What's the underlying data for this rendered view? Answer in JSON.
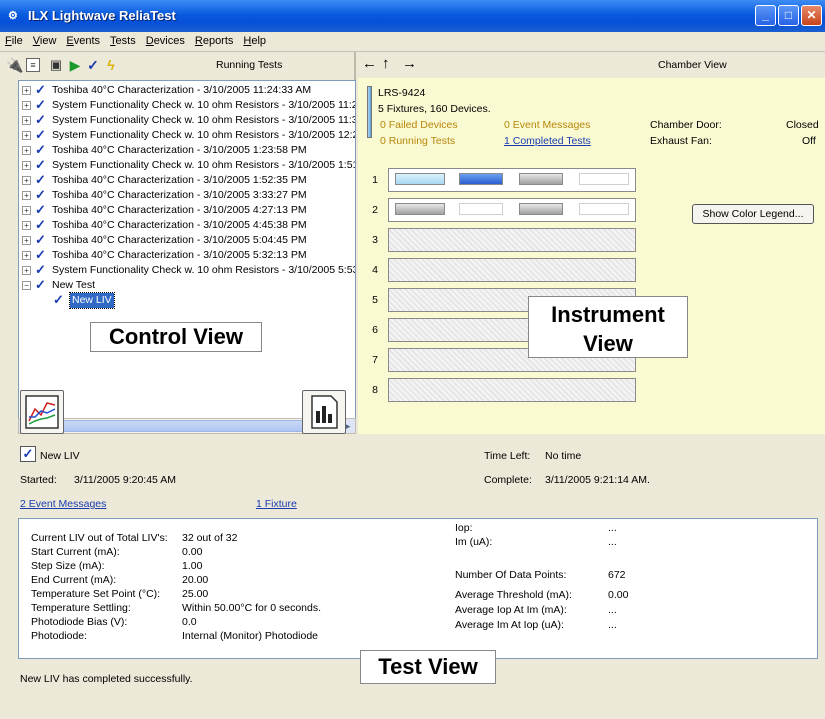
{
  "window": {
    "title": "ILX Lightwave ReliaTest",
    "min": "_",
    "max": "□",
    "close": "✕"
  },
  "menu": [
    "File",
    "View",
    "Events",
    "Tests",
    "Devices",
    "Reports",
    "Help"
  ],
  "control": {
    "header": "Running Tests",
    "tree": [
      {
        "text": "Toshiba 40°C Characterization - 3/10/2005 11:24:33 AM",
        "expander": "+"
      },
      {
        "text": "System Functionality Check w. 10 ohm Resistors - 3/10/2005 11:2",
        "expander": "+"
      },
      {
        "text": "System Functionality Check w. 10 ohm Resistors - 3/10/2005 11:3",
        "expander": "+"
      },
      {
        "text": "System Functionality Check w. 10 ohm Resistors - 3/10/2005 12:2",
        "expander": "+"
      },
      {
        "text": "Toshiba 40°C Characterization - 3/10/2005 1:23:58 PM",
        "expander": "+"
      },
      {
        "text": "System Functionality Check w. 10 ohm Resistors - 3/10/2005 1:51",
        "expander": "+"
      },
      {
        "text": "Toshiba 40°C Characterization - 3/10/2005 1:52:35 PM",
        "expander": "+"
      },
      {
        "text": "Toshiba 40°C Characterization - 3/10/2005 3:33:27 PM",
        "expander": "+"
      },
      {
        "text": "Toshiba 40°C Characterization - 3/10/2005 4:27:13 PM",
        "expander": "+"
      },
      {
        "text": "Toshiba 40°C Characterization - 3/10/2005 4:45:38 PM",
        "expander": "+"
      },
      {
        "text": "Toshiba 40°C Characterization - 3/10/2005 5:04:45 PM",
        "expander": "+"
      },
      {
        "text": "Toshiba 40°C Characterization - 3/10/2005 5:32:13 PM",
        "expander": "+"
      },
      {
        "text": "System Functionality Check w. 10 ohm Resistors - 3/10/2005 5:53",
        "expander": "+"
      },
      {
        "text": "New Test",
        "expander": "−"
      }
    ],
    "child": "New LIV",
    "callout": "Control View"
  },
  "instrument": {
    "header": "Chamber View",
    "model": "LRS-9424",
    "summary": "5 Fixtures, 160 Devices.",
    "failed": "0 Failed Devices",
    "events": "0 Event Messages",
    "running": "0 Running Tests",
    "completed": "1 Completed Tests",
    "door_label": "Chamber Door:",
    "door_value": "Closed",
    "fan_label": "Exhaust Fan:",
    "fan_value": "Off",
    "slots": [
      "1",
      "2",
      "3",
      "4",
      "5",
      "6",
      "7",
      "8"
    ],
    "legend_button": "Show Color Legend...",
    "callout_line1": "Instrument",
    "callout_line2": "View",
    "colors": {
      "light_blue": "#a8d8f0",
      "blue": "#2b5fcf",
      "gray": "#a0a0a0",
      "panel": "#fafad2"
    }
  },
  "test": {
    "name": "New LIV",
    "started_label": "Started:",
    "started_value": "3/11/2005 9:20:45 AM",
    "time_left_label": "Time Left:",
    "time_left_value": "No time",
    "complete_label": "Complete:",
    "complete_value": "3/11/2005 9:21:14 AM.",
    "events_link": "2 Event Messages",
    "fixture_link": "1 Fixture",
    "left": [
      {
        "label": "Current LIV out of Total LIV's:",
        "value": "32 out of 32"
      },
      {
        "label": "Start Current (mA):",
        "value": "0.00"
      },
      {
        "label": "Step Size (mA):",
        "value": "1.00"
      },
      {
        "label": "End Current (mA):",
        "value": "20.00"
      },
      {
        "label": "Temperature Set Point (°C):",
        "value": "25.00"
      },
      {
        "label": "Temperature Settling:",
        "value": "Within 50.00°C for 0 seconds."
      },
      {
        "label": "Photodiode Bias (V):",
        "value": "0.0"
      },
      {
        "label": "Photodiode:",
        "value": "Internal (Monitor) Photodiode"
      }
    ],
    "right": [
      {
        "label": "Iop:",
        "value": "..."
      },
      {
        "label": "Im (uA):",
        "value": "..."
      },
      {
        "label": "Number Of Data Points:",
        "value": "672"
      },
      {
        "label": "Average Threshold (mA):",
        "value": "0.00"
      },
      {
        "label": "Average Iop At Im (mA):",
        "value": "..."
      },
      {
        "label": "Average Im At Iop (uA):",
        "value": "..."
      }
    ],
    "status": "New LIV has completed successfully.",
    "callout": "Test View"
  }
}
